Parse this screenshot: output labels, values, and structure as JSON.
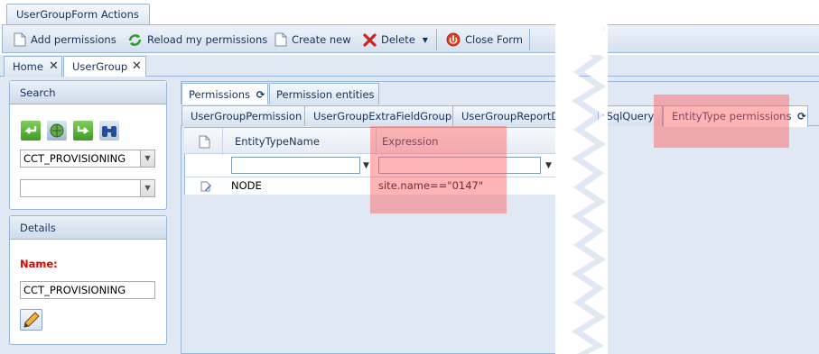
{
  "ribbon": {
    "tab_label": "UserGroupForm Actions",
    "buttons": [
      {
        "label": "Add permissions",
        "icon": "document-icon"
      },
      {
        "label": "Reload my permissions",
        "icon": "reload-icon"
      },
      {
        "label": "Create new",
        "icon": "document-icon"
      },
      {
        "label": "Delete",
        "icon": "delete-x-icon"
      },
      {
        "label": "Close Form",
        "icon": "close-form-icon"
      }
    ]
  },
  "doc_tabs": [
    {
      "label": "Home"
    },
    {
      "label": "UserGroup"
    }
  ],
  "search_panel": {
    "title": "Search",
    "icons": [
      "back-arrow-icon",
      "refresh-globe-icon",
      "forward-arrow-icon",
      "binoculars-icon"
    ],
    "combo1_value": "CCT_PROVISIONING",
    "combo2_value": ""
  },
  "details_panel": {
    "title": "Details",
    "name_label": "Name:",
    "name_value": "CCT_PROVISIONING",
    "edit_icon": "pencil-icon"
  },
  "top_tabs": [
    {
      "label": "Permissions"
    },
    {
      "label": "Permission entities"
    }
  ],
  "sub_tabs": [
    {
      "label": "UserGroupPermission"
    },
    {
      "label": "UserGroupExtraFieldGroup"
    },
    {
      "label": "UserGroupReportDoc"
    },
    {
      "label": "tSqlQuery"
    },
    {
      "label": "EntityType permissions"
    }
  ],
  "grid": {
    "columns": [
      "EntityTypeName",
      "Expression"
    ],
    "rows": [
      {
        "entity_type_name": "NODE",
        "expression": "site.name==\"0147\""
      }
    ]
  },
  "colors": {
    "accent": "#15325b",
    "border": "#99b6d8",
    "highlight": "#ff5a5a",
    "required_label": "#e00000"
  }
}
